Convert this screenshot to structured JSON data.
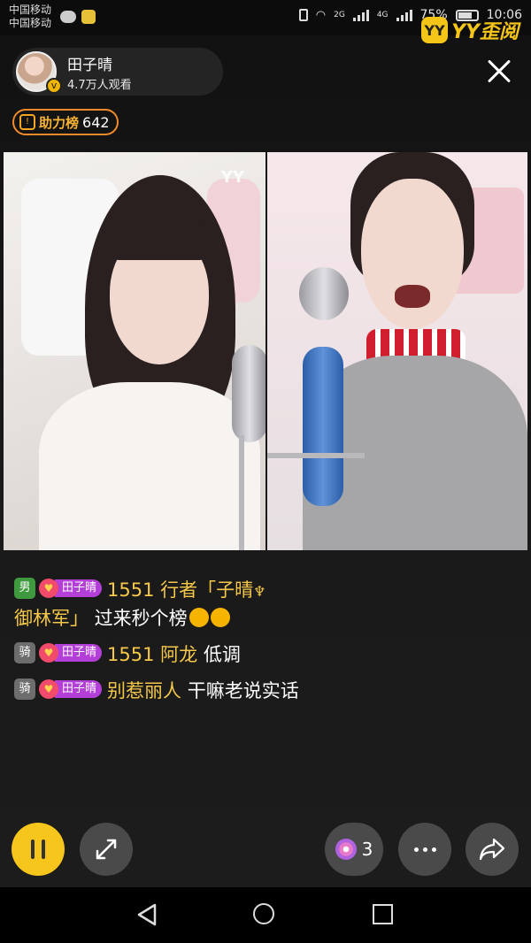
{
  "status_bar": {
    "carrier_1": "中国移动",
    "carrier_2": "中国移动",
    "net_1": "2G",
    "net_2": "4G",
    "battery": "75%",
    "time": "10:06"
  },
  "watermark": {
    "logo": "YY",
    "text": "YY歪阅"
  },
  "anchor": {
    "name": "田子晴",
    "viewers": "4.7万人观看"
  },
  "rank": {
    "label": "助力榜",
    "value": "642"
  },
  "video": {
    "overlay_logo": "YY"
  },
  "chat": [
    {
      "badge": "男",
      "badge_type": "male",
      "fan_tag": "田子晴",
      "nick": "1551 行者「子晴",
      "nick_cont": "御林军」",
      "text": " 过来秒个榜"
    },
    {
      "badge": "骑",
      "badge_type": "rider",
      "fan_tag": "田子晴",
      "nick": "1551 阿龙",
      "text": " 低调"
    },
    {
      "badge": "骑",
      "badge_type": "rider",
      "fan_tag": "田子晴",
      "nick": "别惹丽人",
      "text": " 干嘛老说实话"
    }
  ],
  "controls": {
    "gift_count": "3"
  },
  "colors": {
    "accent_yellow": "#f7c61c",
    "nick_gold": "#f5c84a",
    "fan_purple": "#b43fd8",
    "rank_orange": "#f08a2b"
  }
}
